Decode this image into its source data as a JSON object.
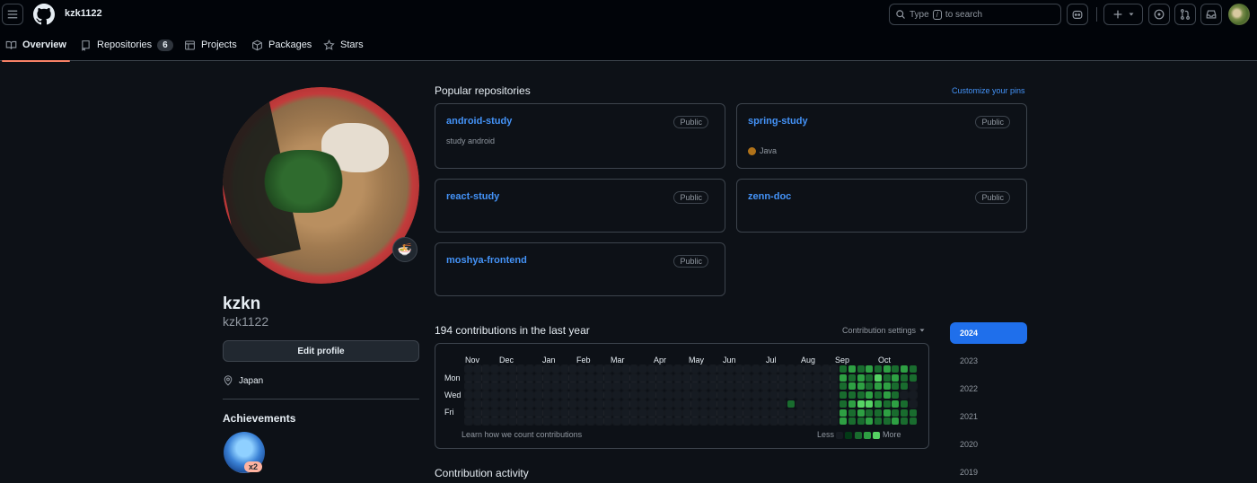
{
  "header": {
    "username": "kzk1122",
    "search_label_pre": "Type",
    "search_key": "/",
    "search_label_post": "to search"
  },
  "tabs": [
    {
      "label": "Overview",
      "icon": "book-icon"
    },
    {
      "label": "Repositories",
      "icon": "repo-icon",
      "count": "6"
    },
    {
      "label": "Projects",
      "icon": "table-icon"
    },
    {
      "label": "Packages",
      "icon": "package-icon"
    },
    {
      "label": "Stars",
      "icon": "star-icon"
    }
  ],
  "profile": {
    "display_name": "kzkn",
    "login": "kzk1122",
    "edit_label": "Edit profile",
    "location": "Japan",
    "achievements_title": "Achievements",
    "achievement_count": "x2",
    "status_emoji": "🍜"
  },
  "popular": {
    "title": "Popular repositories",
    "customize": "Customize your pins",
    "repos": [
      {
        "name": "android-study",
        "visibility": "Public",
        "desc": "study android"
      },
      {
        "name": "spring-study",
        "visibility": "Public",
        "lang": "Java",
        "lang_color": "#b07219"
      },
      {
        "name": "react-study",
        "visibility": "Public"
      },
      {
        "name": "zenn-doc",
        "visibility": "Public"
      },
      {
        "name": "moshya-frontend",
        "visibility": "Public"
      }
    ]
  },
  "contrib": {
    "title": "194 contributions in the last year",
    "settings": "Contribution settings",
    "months": [
      "Nov",
      "Dec",
      "Jan",
      "Feb",
      "Mar",
      "Apr",
      "May",
      "Jun",
      "Jul",
      "Aug",
      "Sep",
      "Oct"
    ],
    "days": [
      "Mon",
      "Wed",
      "Fri"
    ],
    "learn": "Learn how we count contributions",
    "less": "Less",
    "more": "More",
    "level_colors": [
      "#161b22",
      "#033a16",
      "#196c2e",
      "#2ea043",
      "#56d364"
    ],
    "active_weeks": [
      [
        0,
        0,
        0,
        0,
        2,
        0,
        0
      ],
      [
        0,
        0,
        0,
        0,
        0,
        0,
        0
      ],
      [
        0,
        0,
        0,
        0,
        0,
        0,
        0
      ],
      [
        0,
        0,
        0,
        0,
        0,
        0,
        0
      ],
      [
        0,
        0,
        0,
        0,
        0,
        0,
        0
      ],
      [
        0,
        0,
        0,
        0,
        0,
        0,
        0
      ],
      [
        2,
        3,
        2,
        2,
        2,
        3,
        3
      ],
      [
        3,
        2,
        3,
        2,
        3,
        2,
        2
      ],
      [
        2,
        3,
        3,
        2,
        4,
        3,
        2
      ],
      [
        3,
        2,
        2,
        3,
        4,
        2,
        3
      ],
      [
        2,
        4,
        3,
        2,
        3,
        2,
        2
      ],
      [
        3,
        2,
        3,
        3,
        2,
        3,
        2
      ],
      [
        2,
        3,
        2,
        2,
        3,
        2,
        3
      ],
      [
        3,
        2,
        2,
        0,
        2,
        2,
        2
      ],
      [
        2,
        2,
        0,
        0,
        0,
        2,
        2
      ]
    ]
  },
  "activity_title": "Contribution activity",
  "years": [
    "2024",
    "2023",
    "2022",
    "2021",
    "2020",
    "2019"
  ]
}
